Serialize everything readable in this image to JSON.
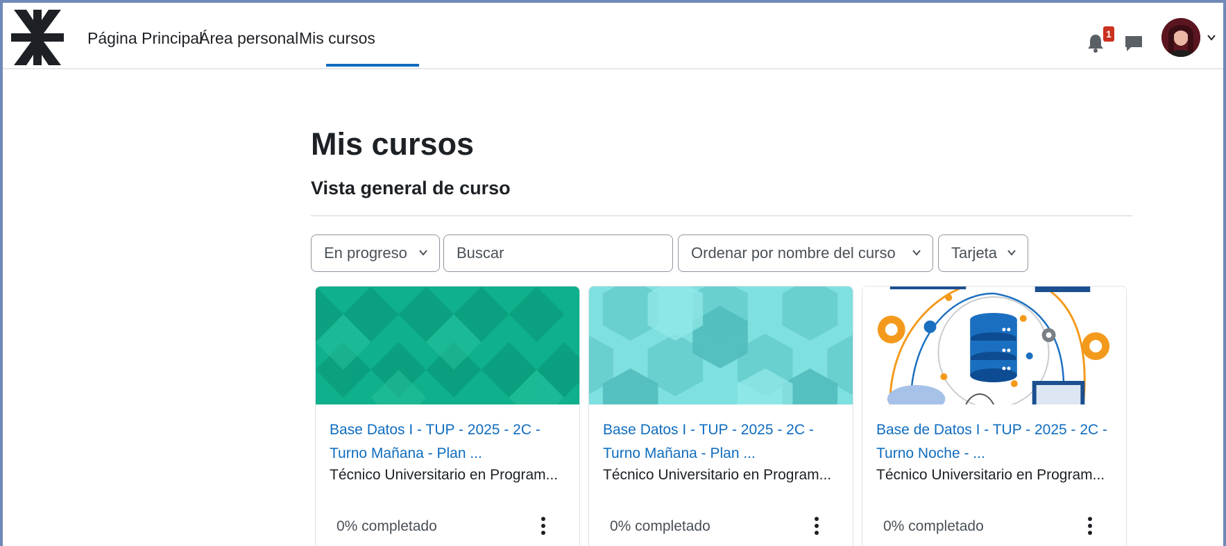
{
  "colors": {
    "accent": "#0f6cbf",
    "badge": "#ca3120",
    "frame": "#6f89b8"
  },
  "navbar": {
    "logo": "utn-logo",
    "items": [
      {
        "label": "Página Principal",
        "active": false
      },
      {
        "label": "Área personal",
        "active": false
      },
      {
        "label": "Mis cursos",
        "active": true
      }
    ],
    "notifications": {
      "icon": "bell-icon",
      "count": "1"
    },
    "messages": {
      "icon": "chat-icon"
    },
    "user_menu": {
      "icon": "avatar",
      "caret": "chevron-down-icon"
    }
  },
  "main": {
    "page_title": "Mis cursos",
    "section_title": "Vista general de curso",
    "filters": {
      "grouping": "En progreso",
      "search_placeholder": "Buscar",
      "sort": "Ordenar por nombre del curso",
      "view": "Tarjeta"
    },
    "courses": [
      {
        "title_line1": "Base Datos I - TUP - 2025 - 2C -",
        "title_line2": "Turno Mañana - Plan ...",
        "category": "Técnico Universitario en Program...",
        "progress": "0% completado",
        "image": "green-geometric-pattern"
      },
      {
        "title_line1": "Base Datos I - TUP - 2025 - 2C -",
        "title_line2": "Turno Mañana - Plan ...",
        "category": "Técnico Universitario en Program...",
        "progress": "0% completado",
        "image": "cyan-hexagon-pattern"
      },
      {
        "title_line1": "Base de Datos I - TUP - 2025 - 2C -",
        "title_line2": "Turno Noche - ...",
        "category": "Técnico Universitario en Program...",
        "progress": "0% completado",
        "image": "database-network-illustration"
      }
    ]
  }
}
